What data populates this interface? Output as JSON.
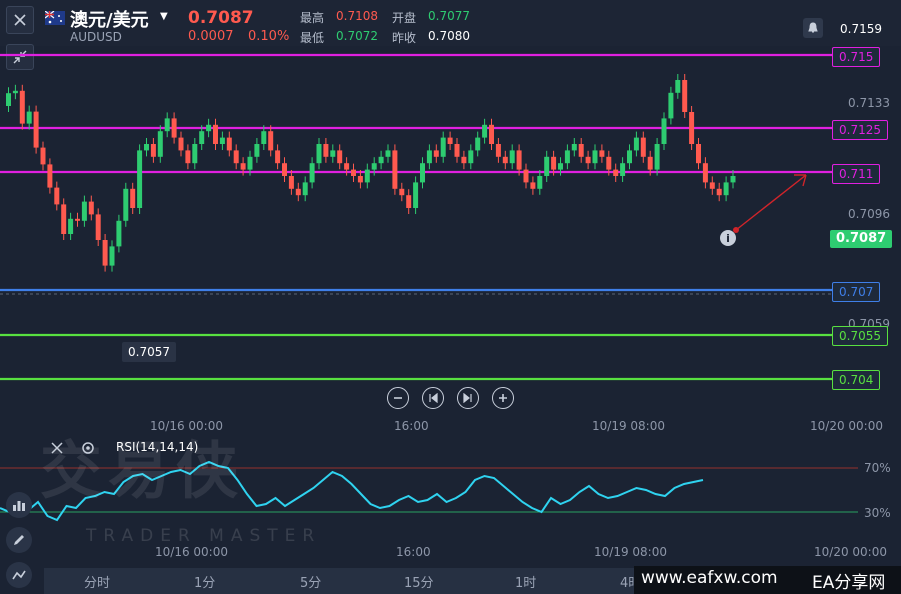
{
  "header": {
    "symbol_name": "澳元/美元",
    "symbol_code": "AUDUSD",
    "price": "0.7087",
    "change": "0.0007",
    "change_pct": "0.10%",
    "high_label": "最高",
    "high_value": "0.7108",
    "open_label": "开盘",
    "open_value": "0.7077",
    "low_label": "最低",
    "low_value": "0.7072",
    "prevclose_label": "昨收",
    "prevclose_value": "0.7080",
    "right_price": "0.7159"
  },
  "price_axis": {
    "ticks": [
      "0.7133",
      "0.7096",
      "0.7059"
    ],
    "current": "0.7087"
  },
  "levels": [
    {
      "label": "0.715",
      "color": "#e020e0"
    },
    {
      "label": "0.7125",
      "color": "#e020e0"
    },
    {
      "label": "0.711",
      "color": "#e020e0"
    },
    {
      "label": "0.707",
      "color": "#3f7fe8"
    },
    {
      "label": "0.7055",
      "color": "#58e040"
    },
    {
      "label": "0.704",
      "color": "#58e040"
    }
  ],
  "low_marker": "0.7057",
  "time_axis": [
    "10/16 00:00",
    "16:00",
    "10/19 08:00",
    "10/20 00:00"
  ],
  "rsi": {
    "label": "RSI(14,14,14)",
    "upper": "70%",
    "lower": "30%",
    "time_axis": [
      "10/16 00:00",
      "16:00",
      "10/19 08:00",
      "10/20 00:00"
    ]
  },
  "watermark": {
    "main": "交易侠",
    "sub": "TRADER MASTER"
  },
  "tabs": [
    "分时",
    "1分",
    "5分",
    "15分",
    "1时",
    "4时"
  ],
  "brand": {
    "site": "www.eafxw.com",
    "name": "EA分享网"
  },
  "colors": {
    "up": "#2ecc71",
    "down": "#ff5a4f",
    "bg": "#1b2333",
    "rsi": "#2fd3f0"
  }
}
